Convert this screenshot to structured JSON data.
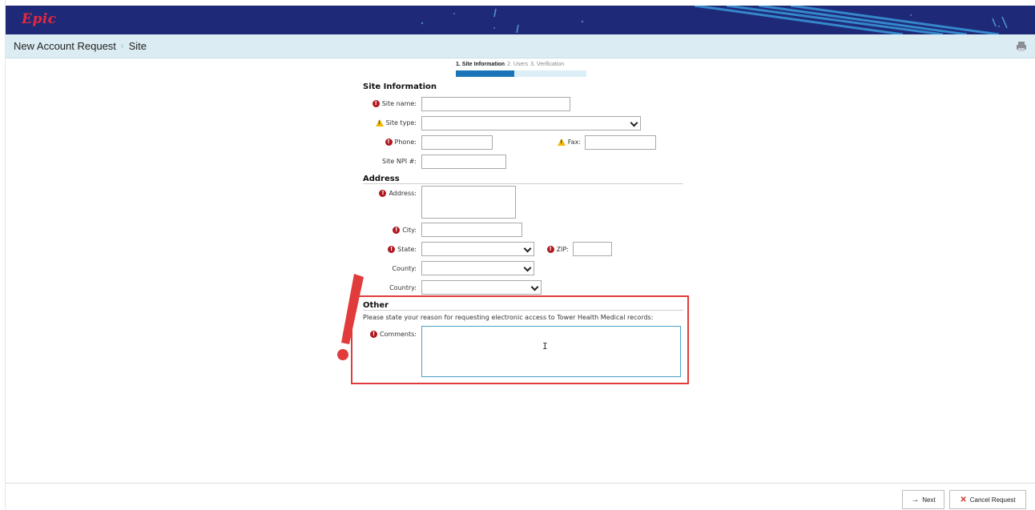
{
  "app": {
    "logo_text": "Epic"
  },
  "breadcrumb": {
    "root": "New Account Request",
    "current": "Site"
  },
  "steps": [
    {
      "label": "1. Site Information",
      "active": true
    },
    {
      "label": "2. Users",
      "active": false
    },
    {
      "label": "3. Verification",
      "active": false
    }
  ],
  "progress": {
    "completed_fraction": 0.45
  },
  "site_info": {
    "title": "Site Information",
    "site_name_label": "Site name:",
    "site_type_label": "Site type:",
    "phone_label": "Phone:",
    "fax_label": "Fax:",
    "site_npi_label": "Site NPI #:"
  },
  "address": {
    "title": "Address",
    "address_label": "Address:",
    "city_label": "City:",
    "state_label": "State:",
    "zip_label": "ZIP:",
    "county_label": "County:",
    "country_label": "Country:"
  },
  "other": {
    "title": "Other",
    "prompt": "Please state your reason for requesting electronic access to Tower Health Medical records:",
    "comments_label": "Comments:"
  },
  "footer": {
    "next_label": "Next",
    "cancel_label": "Cancel Request"
  },
  "colors": {
    "topbar": "#1e2a78",
    "required": "#b0181f",
    "warning": "#f2b705",
    "accent": "#1a76b8",
    "highlight": "#e23b3b"
  },
  "icons": {
    "required": "required-icon",
    "warning": "warning-icon",
    "print": "printer-icon",
    "next": "arrow-right-icon",
    "cancel": "close-icon"
  }
}
